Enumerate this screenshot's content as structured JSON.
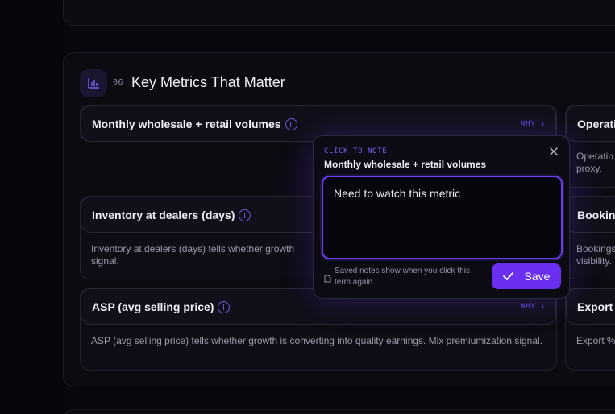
{
  "section": {
    "number": "06",
    "title": "Key Metrics That Matter"
  },
  "cards": {
    "monthly": {
      "title": "Monthly wholesale + retail volumes",
      "why": "WHY ↓"
    },
    "inventory": {
      "title": "Inventory at dealers (days)",
      "description": "Inventory at dealers (days) tells whether growth signal."
    },
    "asp": {
      "title": "ASP (avg selling price)",
      "why": "WHY ↓",
      "description": "ASP (avg selling price) tells whether growth is converting into quality earnings. Mix premiumization signal."
    },
    "right_column": {
      "opera": {
        "title": "Operati",
        "description": "Operatin proxy."
      },
      "booking": {
        "title": "Booking",
        "description": "Bookings visibility."
      },
      "export": {
        "title": "Export",
        "description": "Export %"
      }
    }
  },
  "note_popup": {
    "kicker": "CLICK-TO-NOTE",
    "title": "Monthly wholesale + retail volumes",
    "note_value": "Need to watch this metric",
    "hint": "Saved notes show when you click this term again.",
    "save_label": "Save"
  },
  "colors": {
    "accent": "#6a2ff0",
    "accent_text": "#7b5cf0",
    "background": "#08070d",
    "card": "#0e0d15"
  },
  "icons": [
    "bar-chart-icon",
    "info-icon",
    "close-icon",
    "note-icon",
    "check-icon"
  ]
}
